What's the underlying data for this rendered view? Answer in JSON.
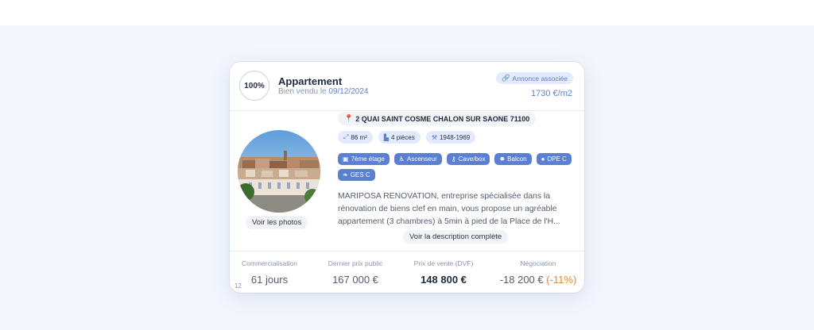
{
  "property": {
    "score": "100%",
    "type": "Appartement",
    "sold_prefix": "Bien vendu le",
    "sold_date": "09/12/2024",
    "annonce_label": "Annonce associée",
    "price_per_m2": "1730 €/m2"
  },
  "address": "2 QUAI SAINT COSME CHALON SUR SAONE 71100",
  "chips": {
    "surface": "86 m²",
    "rooms": "4 pièces",
    "period": "1948-1969"
  },
  "features": [
    "7ème étage",
    "Ascenseur",
    "Cave/box",
    "Balcon",
    "DPE C",
    "GES C"
  ],
  "photos_button": "Voir les photos",
  "description": {
    "line1": "MARIPOSA RENOVATION, entreprise spécialisée dans la",
    "line2": "rénovation de biens clef en main, vous propose un agréable",
    "line3": "appartement (3 chambres) à 5min à pied de la Place de l'H...",
    "button": "Voir la description complète"
  },
  "stats": {
    "commercialisation_label": "Commercialisation",
    "commercialisation_value": "61 jours",
    "dernier_prix_label": "Dernier prix public",
    "dernier_prix_value": "167 000 €",
    "prix_vente_label": "Prix de vente (DVF)",
    "prix_vente_value": "148 800 €",
    "negociation_label": "Négociation",
    "negociation_value": "-18 200 €",
    "negociation_pct": "(-11%)"
  },
  "page_number": "12",
  "colors": {
    "accent": "#5b7fd1",
    "accent_light": "#e3eafb",
    "negative_pct": "#e38a2b",
    "background": "#f3f6fd"
  },
  "icons": {
    "annonce": "link-icon",
    "address": "map-pin-icon",
    "surface": "resize-arrows-icon",
    "rooms": "building-icon",
    "period": "hammer-icon",
    "floor": "elevator-cabin-icon",
    "elevator": "accessibility-icon",
    "cave": "key-icon",
    "balcony": "sun-icon",
    "dpe": "lightbulb-icon",
    "ges": "leaf-icon"
  }
}
